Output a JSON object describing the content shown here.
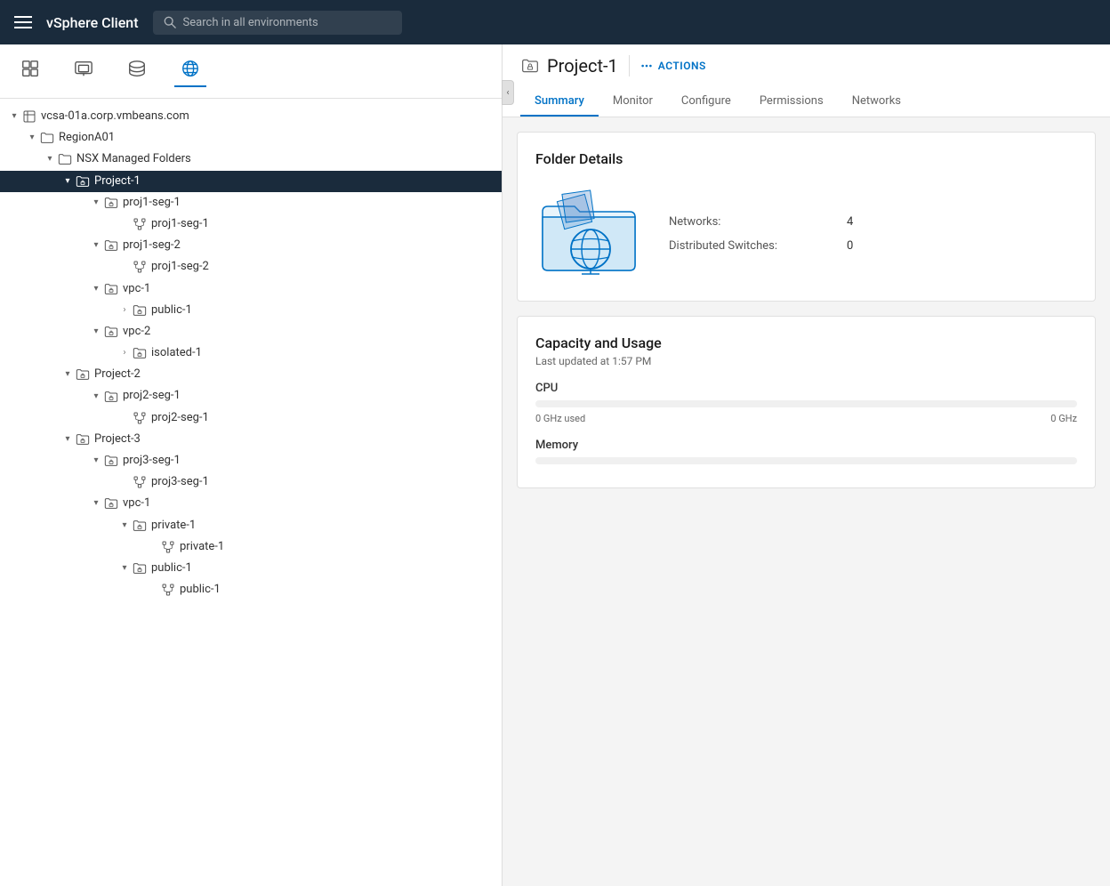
{
  "topbar": {
    "menu_label": "Menu",
    "title": "vSphere Client",
    "search_placeholder": "Search in all environments"
  },
  "nav_icons": [
    {
      "name": "nav-icon-inventory",
      "label": "Inventory"
    },
    {
      "name": "nav-icon-vms",
      "label": "VMs"
    },
    {
      "name": "nav-icon-storage",
      "label": "Storage"
    },
    {
      "name": "nav-icon-networks",
      "label": "Networks",
      "active": true
    }
  ],
  "tree": [
    {
      "id": "vcsa",
      "label": "vcsa-01a.corp.vmbeans.com",
      "indent": 8,
      "chevron": "down",
      "icon": "datacenter",
      "selected": false
    },
    {
      "id": "region",
      "label": "RegionA01",
      "indent": 28,
      "chevron": "down",
      "icon": "folder",
      "selected": false
    },
    {
      "id": "nsx",
      "label": "NSX Managed Folders",
      "indent": 48,
      "chevron": "down",
      "icon": "folder",
      "selected": false
    },
    {
      "id": "project1",
      "label": "Project-1",
      "indent": 68,
      "chevron": "down",
      "icon": "folder-lock",
      "selected": true
    },
    {
      "id": "proj1-seg1-parent",
      "label": "proj1-seg-1",
      "indent": 100,
      "chevron": "down",
      "icon": "folder-lock",
      "selected": false
    },
    {
      "id": "proj1-seg1-child",
      "label": "proj1-seg-1",
      "indent": 132,
      "chevron": "none",
      "icon": "network-seg",
      "selected": false
    },
    {
      "id": "proj1-seg2-parent",
      "label": "proj1-seg-2",
      "indent": 100,
      "chevron": "down",
      "icon": "folder-lock",
      "selected": false
    },
    {
      "id": "proj1-seg2-child",
      "label": "proj1-seg-2",
      "indent": 132,
      "chevron": "none",
      "icon": "network-seg",
      "selected": false
    },
    {
      "id": "vpc1",
      "label": "vpc-1",
      "indent": 100,
      "chevron": "down",
      "icon": "folder-lock",
      "selected": false
    },
    {
      "id": "public1",
      "label": "public-1",
      "indent": 132,
      "chevron": "right",
      "icon": "folder-lock",
      "selected": false
    },
    {
      "id": "vpc2",
      "label": "vpc-2",
      "indent": 100,
      "chevron": "down",
      "icon": "folder-lock",
      "selected": false
    },
    {
      "id": "isolated1",
      "label": "isolated-1",
      "indent": 132,
      "chevron": "right",
      "icon": "folder-lock",
      "selected": false
    },
    {
      "id": "project2",
      "label": "Project-2",
      "indent": 68,
      "chevron": "down",
      "icon": "folder-lock",
      "selected": false
    },
    {
      "id": "proj2-seg1-parent",
      "label": "proj2-seg-1",
      "indent": 100,
      "chevron": "down",
      "icon": "folder-lock",
      "selected": false
    },
    {
      "id": "proj2-seg1-child",
      "label": "proj2-seg-1",
      "indent": 132,
      "chevron": "none",
      "icon": "network-seg",
      "selected": false
    },
    {
      "id": "project3",
      "label": "Project-3",
      "indent": 68,
      "chevron": "down",
      "icon": "folder-lock",
      "selected": false
    },
    {
      "id": "proj3-seg1-parent",
      "label": "proj3-seg-1",
      "indent": 100,
      "chevron": "down",
      "icon": "folder-lock",
      "selected": false
    },
    {
      "id": "proj3-seg1-child",
      "label": "proj3-seg-1",
      "indent": 132,
      "chevron": "none",
      "icon": "network-seg",
      "selected": false
    },
    {
      "id": "vpc1-3",
      "label": "vpc-1",
      "indent": 100,
      "chevron": "down",
      "icon": "folder-lock",
      "selected": false
    },
    {
      "id": "private1-parent",
      "label": "private-1",
      "indent": 132,
      "chevron": "down",
      "icon": "folder-lock",
      "selected": false
    },
    {
      "id": "private1-child",
      "label": "private-1",
      "indent": 164,
      "chevron": "none",
      "icon": "network-seg",
      "selected": false
    },
    {
      "id": "public1-p3",
      "label": "public-1",
      "indent": 132,
      "chevron": "down",
      "icon": "folder-lock",
      "selected": false
    },
    {
      "id": "public1-p3-child",
      "label": "public-1",
      "indent": 164,
      "chevron": "none",
      "icon": "network-seg",
      "selected": false
    }
  ],
  "right_panel": {
    "title": "Project-1",
    "actions_label": "ACTIONS",
    "tabs": [
      {
        "id": "summary",
        "label": "Summary",
        "active": true
      },
      {
        "id": "monitor",
        "label": "Monitor",
        "active": false
      },
      {
        "id": "configure",
        "label": "Configure",
        "active": false
      },
      {
        "id": "permissions",
        "label": "Permissions",
        "active": false
      },
      {
        "id": "networks",
        "label": "Networks",
        "active": false
      }
    ]
  },
  "folder_details": {
    "title": "Folder Details",
    "networks_label": "Networks:",
    "networks_value": "4",
    "switches_label": "Distributed Switches:",
    "switches_value": "0"
  },
  "capacity": {
    "title": "Capacity and Usage",
    "subtitle": "Last updated at 1:57 PM",
    "cpu_label": "CPU",
    "cpu_used": "0 GHz used",
    "cpu_total": "0 GHz",
    "memory_label": "Memory"
  },
  "colors": {
    "accent": "#0072c6",
    "topbar_bg": "#1a2b3c",
    "selected_bg": "#1a2b3c"
  }
}
